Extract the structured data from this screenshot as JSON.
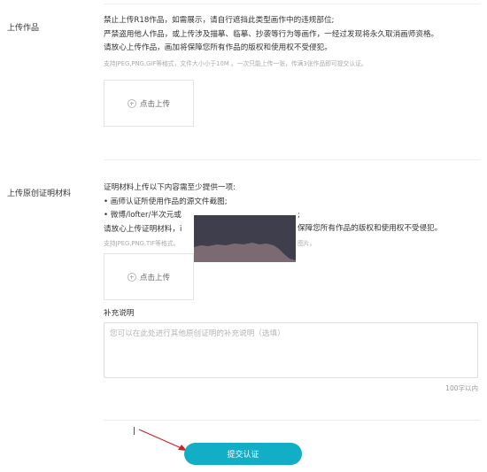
{
  "upload_work": {
    "label": "上传作品",
    "rules": [
      "禁止上传R18作品，如需展示，请自行遮挡此类型画作中的违规部位;",
      "严禁盗用他人作品，或上传涉及描摹、临摹、抄袭等行为等画作，一经过发现将永久取消画师资格。",
      "请放心上传作品，画加将保障您所有作品的版权和使用权不受侵犯。"
    ],
    "hint": "支持JPEG,PNG,GIF等格式，文件大小小于10M 。一次只能上传一张，传满3张作品即可提交认证。",
    "upload_label": "点击上传"
  },
  "proof": {
    "label": "上传原创证明材料",
    "rules": [
      "证明材料上传以下内容需至少提供一项:",
      "• 画师认证所使用作品的源文件截图;",
      "• 微博/lofter/半次元或",
      "请放心上传证明材料，i"
    ],
    "rules_right": [
      ";",
      "保障您所有作品的版权和使用权不受侵犯。"
    ],
    "hint_left": "支持JPEG,PNG,TIF等格式。",
    "hint_right": "图片。",
    "upload_label": "点击上传"
  },
  "supplement": {
    "label": "补充说明",
    "placeholder": "您可以在此处进行其他原创证明的补充说明（选填）",
    "counter": "100字以内"
  },
  "submit_label": "提交认证",
  "colors": {
    "accent": "#11aec5",
    "redaction": "#3e3e4c",
    "annotation_arrow": "#cc2222"
  }
}
